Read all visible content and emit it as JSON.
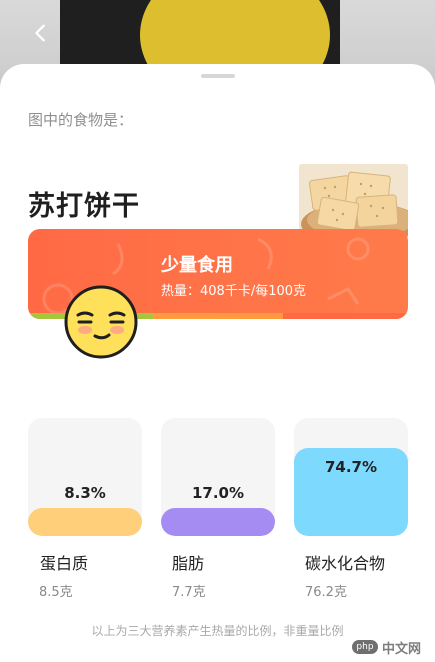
{
  "nav": {
    "back_icon": "chevron-left-icon"
  },
  "sheet": {
    "prompt_label": "图中的食物是：",
    "food_name": "苏打饼干"
  },
  "advice": {
    "title": "少量食用",
    "calories": "热量：408千卡/每100克",
    "emoji": "smirk-face-icon"
  },
  "macros": [
    {
      "name": "蛋白质",
      "percent": "8.3%",
      "percent_value": 8.3,
      "weight": "8.5克",
      "color": "#ffcf7a"
    },
    {
      "name": "脂肪",
      "percent": "17.0%",
      "percent_value": 17.0,
      "weight": "7.7克",
      "color": "#a58cf2"
    },
    {
      "name": "碳水化合物",
      "percent": "74.7%",
      "percent_value": 74.7,
      "weight": "76.2克",
      "color": "#7ed9ff"
    }
  ],
  "note": "以上为三大营养素产生热量的比例，非重量比例",
  "watermark": {
    "logo": "php",
    "text": "中文网"
  },
  "colors": {
    "banner_start": "#ff6a45",
    "banner_end": "#ff7b4a",
    "bar_green": "#a6c63b",
    "bar_orange": "#ff9b3d",
    "bar_red": "#ff6a45"
  }
}
